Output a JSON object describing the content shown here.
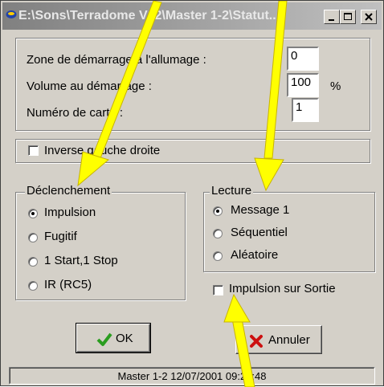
{
  "window": {
    "title": "E:\\Sons\\Terradome V12\\Master 1-2\\Statut..."
  },
  "fields": [
    {
      "label": "Zone de démarrage à l'allumage :",
      "value": "0",
      "unit": ""
    },
    {
      "label": "Volume au démarrage  :",
      "value": "100",
      "unit": "%"
    },
    {
      "label": "Numéro de carte  :",
      "value": "1",
      "unit": ""
    }
  ],
  "inverse": {
    "label": "Inverse gauche droite",
    "checked": false
  },
  "declenchement": {
    "title": "Déclenchement",
    "options": [
      "Impulsion",
      "Fugitif",
      "1 Start,1 Stop",
      "IR (RC5)"
    ],
    "selected": "Impulsion"
  },
  "lecture": {
    "title": "Lecture",
    "options": [
      "Message 1",
      "Séquentiel",
      "Aléatoire"
    ],
    "selected": "Message 1"
  },
  "impulsion_sortie": {
    "label": "Impulsion sur Sortie",
    "checked": false
  },
  "buttons": {
    "ok": "OK",
    "cancel": "Annuler"
  },
  "status": "Master 1-2 12/07/2001 09:25:48",
  "colors": {
    "annotation_arrow": "#ffff00",
    "ok_check": "#2a9d1f",
    "cancel_x": "#cc1010"
  }
}
